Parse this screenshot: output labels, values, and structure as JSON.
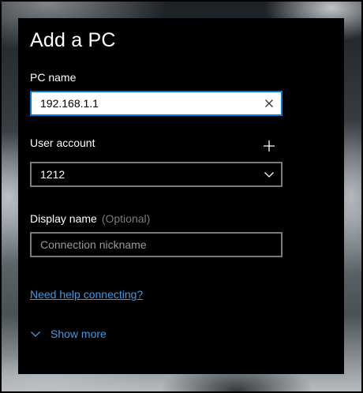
{
  "dialog": {
    "title": "Add a PC"
  },
  "pc_name": {
    "label": "PC name",
    "value": "192.168.1.1"
  },
  "user_account": {
    "label": "User account",
    "selected": "1212"
  },
  "display_name": {
    "label": "Display name",
    "optional_hint": "(Optional)",
    "placeholder": "Connection nickname",
    "value": ""
  },
  "links": {
    "help": "Need help connecting?",
    "show_more": "Show more"
  },
  "colors": {
    "accent": "#0078d7",
    "link": "#3c9be8",
    "dialog_bg": "#000000",
    "border": "#7a7a7a"
  },
  "icons": {
    "clear": "close-icon",
    "add_account": "plus-icon",
    "dropdown": "chevron-down-icon",
    "show_more": "chevron-down-icon"
  }
}
